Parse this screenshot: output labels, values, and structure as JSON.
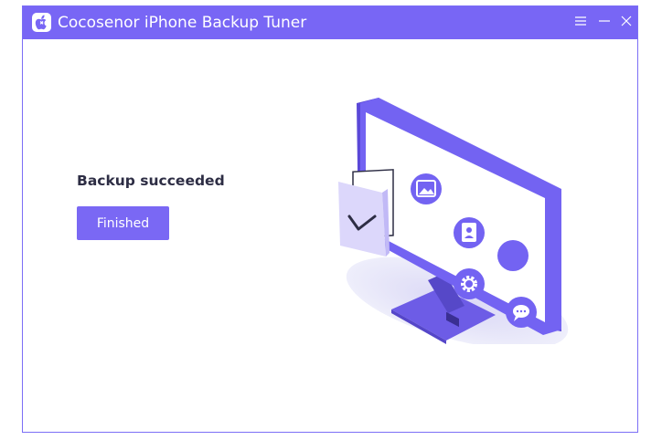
{
  "window": {
    "title": "Cocosenor iPhone Backup Tuner",
    "logo_icon": "app-logo-icon",
    "controls": [
      "menu-icon",
      "minimize-icon",
      "close-icon"
    ]
  },
  "main": {
    "status_text": "Backup succeeded",
    "finished_button_label": "Finished"
  },
  "illustration": {
    "icons": [
      "image-icon",
      "contact-icon",
      "settings-icon",
      "chat-icon",
      "checkmark-icon"
    ]
  },
  "colors": {
    "accent": "#7866f5",
    "text_dark": "#2d2d44"
  }
}
